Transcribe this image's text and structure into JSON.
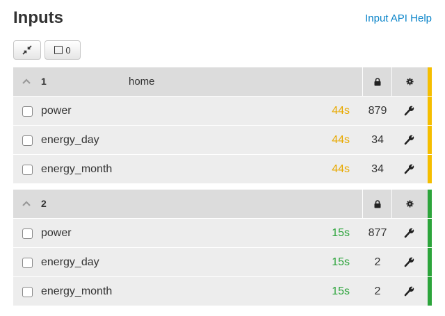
{
  "header": {
    "title": "Inputs",
    "help_link": "Input API Help"
  },
  "toolbar": {
    "select_count": "0"
  },
  "colors": {
    "group1_bar": "#f5be00",
    "group2_bar": "#2ca43b",
    "group1_time": "#e8a900",
    "group2_time": "#2ca43b",
    "link": "#0a84c9"
  },
  "icons": {
    "collapse": "compress-arrows-icon",
    "select": "square-checkbox-icon",
    "lock": "lock-icon",
    "config": "gear-icon",
    "edit": "wrench-icon",
    "expand": "chevron-up-icon"
  },
  "groups": [
    {
      "number": "1",
      "name": "home",
      "inputs": [
        {
          "name": "power",
          "time": "44s",
          "value": "879"
        },
        {
          "name": "energy_day",
          "time": "44s",
          "value": "34"
        },
        {
          "name": "energy_month",
          "time": "44s",
          "value": "34"
        }
      ]
    },
    {
      "number": "2",
      "name": "",
      "inputs": [
        {
          "name": "power",
          "time": "15s",
          "value": "877"
        },
        {
          "name": "energy_day",
          "time": "15s",
          "value": "2"
        },
        {
          "name": "energy_month",
          "time": "15s",
          "value": "2"
        }
      ]
    }
  ]
}
